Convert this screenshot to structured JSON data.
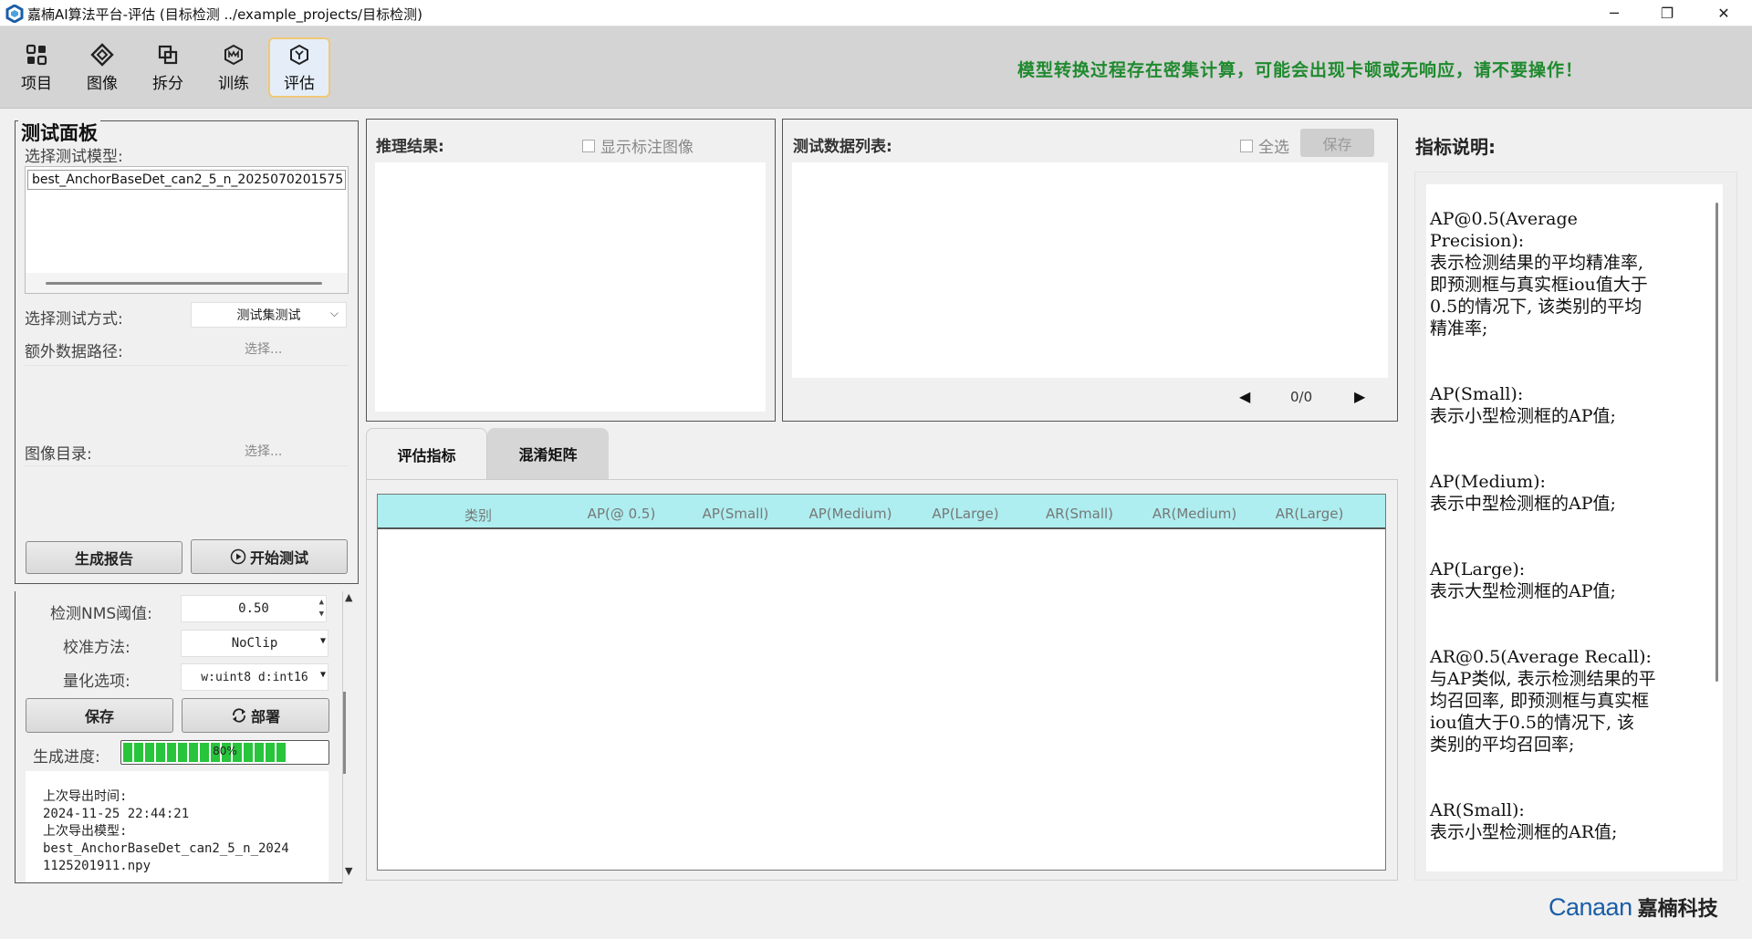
{
  "window": {
    "title": "嘉楠AI算法平台-评估 (目标检测  ../example_projects/目标检测)",
    "controls": [
      "─",
      "❐",
      "✕"
    ]
  },
  "toolbar": {
    "items": [
      {
        "label": "项目",
        "icon": "grid-icon"
      },
      {
        "label": "图像",
        "icon": "image-icon"
      },
      {
        "label": "拆分",
        "icon": "split-icon"
      },
      {
        "label": "训练",
        "icon": "train-icon"
      },
      {
        "label": "评估",
        "icon": "evaluate-icon",
        "active": true
      }
    ],
    "warning": "模型转换过程存在密集计算，可能会出现卡顿或无响应，请不要操作！",
    "warning_color": "#1f8a2e"
  },
  "test_panel": {
    "title": "测试面板",
    "model_label": "选择测试模型:",
    "model_item": "best_AnchorBaseDet_can2_5_n_2025070201575",
    "method_label": "选择测试方式:",
    "method_value": "测试集测试",
    "extra_label": "额外数据路径:",
    "extra_placeholder": "选择...",
    "image_dir_label": "图像目录:",
    "image_dir_placeholder": "选择...",
    "report_button": "生成报告",
    "start_button": "开始测试"
  },
  "deploy_panel": {
    "nms_label": "检测NMS阈值:",
    "nms_value": "0.50",
    "calib_label": "校准方法:",
    "calib_value": "NoClip",
    "quant_label": "量化选项:",
    "quant_value": "w:uint8 d:int16",
    "save_button": "保存",
    "deploy_button": "部署",
    "progress_label": "生成进度:",
    "progress_text": "80%",
    "progress_value": 0.8,
    "log_lines": [
      "上次导出时间:",
      "2024-11-25 22:44:21",
      "上次导出模型:",
      "best_AnchorBaseDet_can2_5_n_2024",
      "1125201911.npy"
    ]
  },
  "inference": {
    "title": "推理结果:",
    "show_annot_label": "显示标注图像"
  },
  "test_data": {
    "title": "测试数据列表:",
    "select_all_label": "全选",
    "save_button": "保存",
    "pager": "0/0"
  },
  "tabs": [
    {
      "label": "评估指标",
      "active": true
    },
    {
      "label": "混淆矩阵",
      "active": false
    }
  ],
  "metrics_table": {
    "columns": [
      "类别",
      "AP(@ 0.5)",
      "AP(Small)",
      "AP(Medium)",
      "AP(Large)",
      "AR(Small)",
      "AR(Medium)",
      "AR(Large)"
    ],
    "header_color": "#aeeef0"
  },
  "metric_desc": {
    "title": "指标说明:",
    "lines": [
      "AP@0.5(Average",
      "Precision):",
      "表示检测结果的平均精准率,",
      "即预测框与真实框iou值大于",
      "0.5的情况下, 该类别的平均",
      "精准率;",
      "",
      "",
      "AP(Small):",
      "表示小型检测框的AP值;",
      "",
      "",
      "AP(Medium):",
      "表示中型检测框的AP值;",
      "",
      "",
      "AP(Large):",
      "表示大型检测框的AP值;",
      "",
      "",
      "AR@0.5(Average Recall):",
      "与AP类似, 表示检测结果的平",
      "均召回率, 即预测框与真实框",
      "iou值大于0.5的情况下, 该",
      "类别的平均召回率;",
      "",
      "",
      "AR(Small):",
      "表示小型检测框的AR值;"
    ]
  },
  "brand": {
    "latin": "Canaan",
    "chinese": "嘉楠科技",
    "color": "#1a5ea8"
  }
}
